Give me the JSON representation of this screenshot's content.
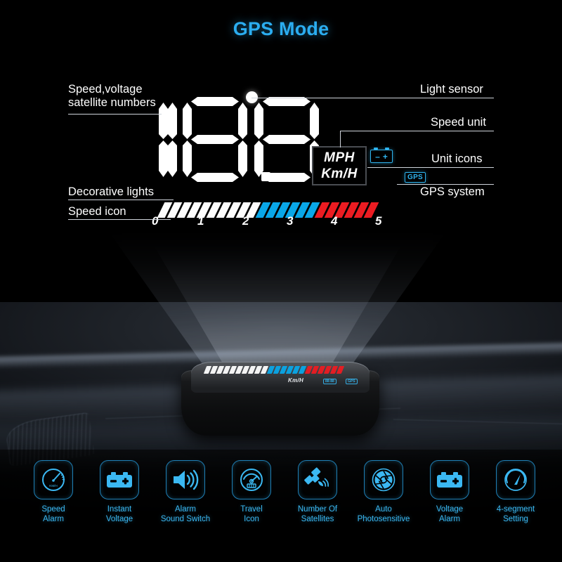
{
  "title": "GPS Mode",
  "hud": {
    "speed_value": "18.8",
    "digits": [
      "1",
      "8",
      "8"
    ],
    "decimal_point": true,
    "sensor_dot": "light-sensor-dot",
    "unit_box": {
      "primary": "MPH",
      "secondary": "Km/H"
    },
    "battery_icon": {
      "minus": "–",
      "plus": "+"
    },
    "gps_badge": "GPS",
    "scale_numbers": [
      "0",
      "1",
      "2",
      "3",
      "4",
      "5"
    ],
    "bar_segments": {
      "total": 22,
      "white": 10,
      "cyan": 6,
      "red": 6,
      "colors": {
        "white": "#fdfdfd",
        "cyan": "#09a7e8",
        "red": "#ec1c22"
      }
    }
  },
  "callouts": {
    "left": [
      {
        "id": "speed-voltage-satellite",
        "line1": "Speed,voltage",
        "line2": "satellite numbers"
      },
      {
        "id": "decorative-lights",
        "line1": "Decorative lights"
      },
      {
        "id": "speed-icon",
        "line1": "Speed icon"
      }
    ],
    "right": [
      {
        "id": "light-sensor",
        "text": "Light sensor"
      },
      {
        "id": "speed-unit",
        "text": "Speed unit"
      },
      {
        "id": "unit-icons",
        "text": "Unit icons"
      },
      {
        "id": "gps-system",
        "text": "GPS system"
      }
    ]
  },
  "device": {
    "screen_text": "Km/H",
    "screen_badges": [
      "88:88",
      "GPS"
    ]
  },
  "features": [
    {
      "id": "speed-alarm",
      "icon": "speedometer-icon",
      "line1": "Speed",
      "line2": "Alarm",
      "inner_text": "KM/H"
    },
    {
      "id": "instant-voltage",
      "icon": "battery-icon",
      "line1": "Instant",
      "line2": "Voltage"
    },
    {
      "id": "alarm-sound-switch",
      "icon": "speaker-icon",
      "line1": "Alarm",
      "line2": "Sound Switch"
    },
    {
      "id": "travel-icon",
      "icon": "gauge-icon",
      "line1": "Travel",
      "line2": "Icon"
    },
    {
      "id": "number-of-satellites",
      "icon": "satellite-icon",
      "line1": "Number Of",
      "line2": "Satellites"
    },
    {
      "id": "auto-photosensitive",
      "icon": "aperture-icon",
      "line1": "Auto",
      "line2": "Photosensitive"
    },
    {
      "id": "voltage-alarm",
      "icon": "battery-icon",
      "line1": "Voltage",
      "line2": "Alarm"
    },
    {
      "id": "4-segment-setting",
      "icon": "gauge-needle-icon",
      "line1": "4-segment",
      "line2": "Setting"
    }
  ],
  "colors": {
    "accent_cyan": "#2badf0",
    "icon_cyan": "#3bb8f2",
    "bar_cyan": "#09a7e8",
    "bar_red": "#ec1c22",
    "text_white": "#ffffff",
    "background": "#000000"
  }
}
